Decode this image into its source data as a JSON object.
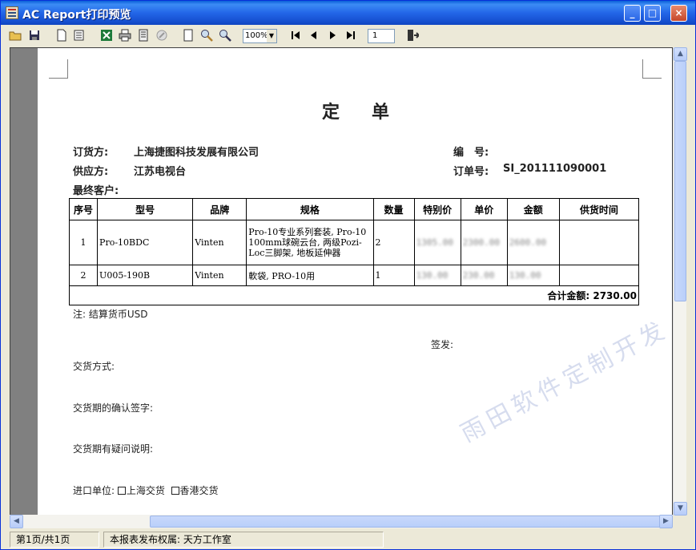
{
  "window": {
    "title": "AC Report打印预览",
    "buttons": {
      "minimize": "_",
      "maximize": "□",
      "close": "×"
    }
  },
  "toolbar": {
    "icons": [
      "open-folder-icon",
      "save-icon",
      "new-page-icon",
      "export-icon",
      "excel-icon",
      "print-icon",
      "page-setup-icon",
      "stop-icon",
      "single-page-icon",
      "zoom-icon",
      "magnify-icon"
    ],
    "zoom_value": "100%",
    "nav": [
      "first-page-icon",
      "prev-page-icon",
      "next-page-icon",
      "last-page-icon"
    ],
    "page_number": "1"
  },
  "document": {
    "title": "定单",
    "fields": {
      "buyer_label": "订货方:",
      "buyer_value": "上海捷图科技发展有限公司",
      "supplier_label": "供应方:",
      "supplier_value": "江苏电视台",
      "customer_label": "最终客户:",
      "number_label": "编　号:",
      "number_value": "",
      "order_no_label": "订单号:",
      "order_no_value": "SI_201111090001"
    },
    "table": {
      "headers": [
        "序号",
        "型号",
        "品牌",
        "规格",
        "数量",
        "特别价",
        "单价",
        "金额",
        "供货时间"
      ],
      "rows": [
        {
          "no": "1",
          "model": "Pro-10BDC",
          "brand": "Vinten",
          "spec": "Pro-10专业系列套装, Pro-10 100mm球碗云台, 两级Pozi-Loc三脚架, 地板延伸器",
          "qty": "2",
          "special": "1305.00",
          "price": "2300.00",
          "amount": "2600.00",
          "delivery": ""
        },
        {
          "no": "2",
          "model": "U005-190B",
          "brand": "Vinten",
          "spec": "軟袋, PRO-10用",
          "qty": "1",
          "special": "130.00",
          "price": "230.00",
          "amount": "130.00",
          "delivery": ""
        }
      ],
      "total_label": "合计金额:",
      "total_value": "2730.00"
    },
    "note": "注: 结算货币USD",
    "sign": "签发:",
    "delivery_method": "交货方式:",
    "delivery_confirm": "交货期的确认签字:",
    "delivery_question": "交货期有疑问说明:",
    "import_unit": "进口单位:",
    "option_shanghai": "上海交货",
    "option_hongkong": "香港交货"
  },
  "watermark": "雨田软件定制开发",
  "status": {
    "page": "第1页/共1页",
    "copyright": "本报表发布权属: 天方工作室"
  }
}
